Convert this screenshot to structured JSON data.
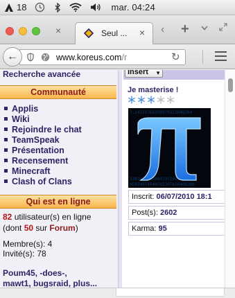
{
  "menubar": {
    "badge": "18",
    "date_time": "mar. 04:24",
    "icons": [
      "adobe-icon",
      "clock-icon",
      "bluetooth-icon",
      "wifi-icon",
      "volume-icon"
    ]
  },
  "tabs": {
    "active_title": "Seul ...",
    "close_glyph": "×",
    "prev_close_glyph": "×",
    "new_tab_glyph": "+",
    "list_glyph": "⌄",
    "scroll_glyph": "‹"
  },
  "navbar": {
    "url_domain": "www.koreus.com",
    "url_path": "/r",
    "reload_glyph": "↻",
    "back_glyph": "←"
  },
  "left": {
    "advanced_search": "Recherche avancée",
    "community_header": "Communauté",
    "menu": [
      "Applis",
      "Wiki",
      "Rejoindre le chat",
      "TeamSpeak",
      "Présentation",
      "Recensement",
      "Minecraft",
      "Clash of Clans"
    ],
    "online_header": "Qui est en ligne",
    "online_count": "82",
    "online_suffix": " utilisateur(s) en ligne",
    "forum_prefix": "(dont ",
    "forum_count": "50",
    "forum_mid": " sur ",
    "forum_label": "Forum",
    "forum_suffix": ")",
    "members": "Membre(s): 4",
    "guests": "Invité(s): 78",
    "users_line1": "Poum45, -does-,",
    "users_line2": "mawt1, bugsraid, plus..."
  },
  "right": {
    "insert_label": "Insert",
    "rank_title": "Je masterise !",
    "rank_flakes_filled": 3,
    "rank_flakes_total": 5,
    "joined_label": "Inscrit: ",
    "joined_value": "06/07/2010 18:1",
    "posts_label": "Post(s): ",
    "posts_value": "2602",
    "karma_label": "Karma: ",
    "karma_value": "95"
  },
  "colors": {
    "link_navy": "#2c2466",
    "header_orange": "#f7b54c",
    "header_text": "#8b1a1a",
    "accent_red": "#b31414",
    "pi_blue": "#3fa7ff"
  }
}
